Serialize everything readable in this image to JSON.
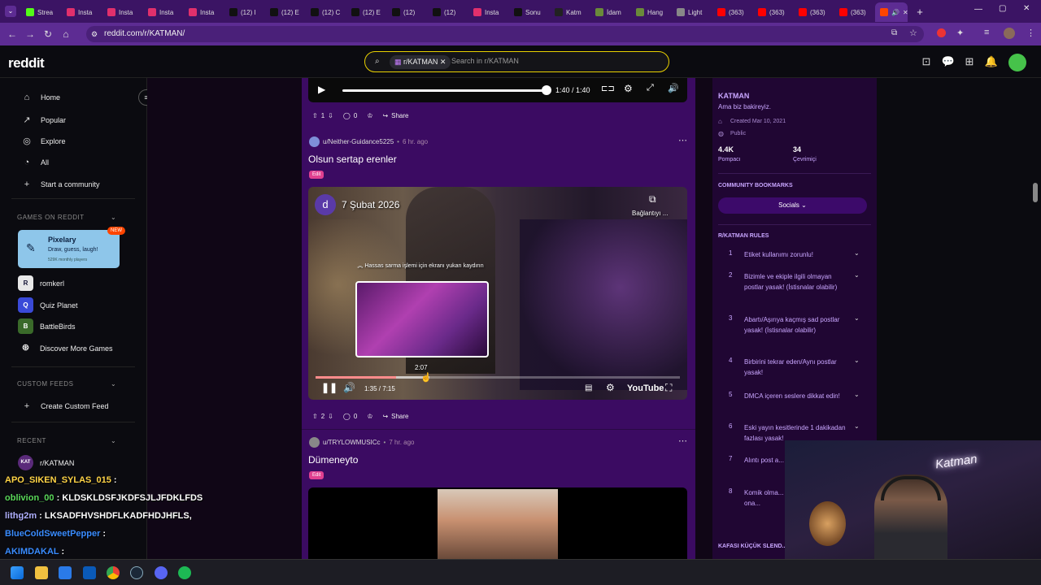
{
  "browser": {
    "tabs": [
      {
        "label": "Strea",
        "icon": "kick-icon",
        "color": "#53fc18"
      },
      {
        "label": "Insta",
        "icon": "instagram-icon",
        "color": "#e1306c"
      },
      {
        "label": "Insta",
        "icon": "instagram-icon",
        "color": "#e1306c"
      },
      {
        "label": "Insta",
        "icon": "instagram-icon",
        "color": "#e1306c"
      },
      {
        "label": "Insta",
        "icon": "instagram-icon",
        "color": "#e1306c"
      },
      {
        "label": "(12) I",
        "icon": "x-icon",
        "color": "#111111"
      },
      {
        "label": "(12) E",
        "icon": "x-icon",
        "color": "#111111"
      },
      {
        "label": "(12) C",
        "icon": "x-icon",
        "color": "#111111"
      },
      {
        "label": "(12) E",
        "icon": "x-icon",
        "color": "#111111"
      },
      {
        "label": "(12) ",
        "icon": "x-icon",
        "color": "#111111"
      },
      {
        "label": "(12) ",
        "icon": "x-icon",
        "color": "#111111"
      },
      {
        "label": "Insta",
        "icon": "instagram-icon",
        "color": "#e1306c"
      },
      {
        "label": "Sonu",
        "icon": "tiktok-icon",
        "color": "#111111"
      },
      {
        "label": "Katm",
        "icon": "github-icon",
        "color": "#222222"
      },
      {
        "label": "İdam",
        "icon": "globe-icon",
        "color": "#6a8a3a"
      },
      {
        "label": "Hang",
        "icon": "globe-icon",
        "color": "#6a8a3a"
      },
      {
        "label": "Light",
        "icon": "pen-icon",
        "color": "#888888"
      },
      {
        "label": "(363)",
        "icon": "youtube-icon",
        "color": "#ff0000"
      },
      {
        "label": "(363)",
        "icon": "youtube-icon",
        "color": "#ff0000"
      },
      {
        "label": "(363)",
        "icon": "youtube-icon",
        "color": "#ff0000"
      },
      {
        "label": "(363)",
        "icon": "youtube-icon",
        "color": "#ff0000"
      }
    ],
    "url": "reddit.com/r/KATMAN/"
  },
  "reddit": {
    "logo": "reddit",
    "search_chip": "r/KATMAN",
    "search_placeholder": "Search in r/KATMAN"
  },
  "sidebar": {
    "nav": [
      {
        "label": "Home",
        "icon": "home-icon"
      },
      {
        "label": "Popular",
        "icon": "popular-icon"
      },
      {
        "label": "Explore",
        "icon": "explore-icon"
      },
      {
        "label": "All",
        "icon": "all-icon"
      },
      {
        "label": "Start a community",
        "icon": "plus-icon"
      }
    ],
    "games_header": "GAMES ON REDDIT",
    "pixelary": {
      "title": "Pixelary",
      "tagline": "Draw, guess, laugh!",
      "players": "529K monthly players",
      "badge": "NEW"
    },
    "games": [
      "romkerl",
      "Quiz Planet",
      "BattleBirds",
      "Discover More Games"
    ],
    "custom_feeds_header": "CUSTOM FEEDS",
    "create_feed": "Create Custom Feed",
    "recent_header": "RECENT",
    "recent": [
      "r/KATMAN"
    ]
  },
  "feed": {
    "top_player": {
      "time": "1:40 / 1:40"
    },
    "post1": {
      "author": "u/Neither-Guidance5225",
      "age": "6 hr. ago",
      "title": "Olsun sertap erenler",
      "flair": "Edit",
      "votes": "1",
      "comments": "0",
      "share": "Share",
      "video": {
        "channel_initial": "d",
        "channel_title": "7 Şubat 2026",
        "copy_label": "Bağlantıyı ...",
        "hint": "Hassas sarma işlemi için ekranı yukarı kaydırın",
        "preview_time": "2:07",
        "time": "1:35 / 7:15",
        "brand": "YouTube",
        "progress": 0.22
      },
      "votes_after": "2",
      "comments_after": "0"
    },
    "post2": {
      "author": "u/TRYLOWMUSICc",
      "age": "7 hr. ago",
      "title": "Dümeneyto",
      "flair": "Edit"
    }
  },
  "community": {
    "name": "KATMAN",
    "tagline": "Ama biz bakireyiz.",
    "created": "Created Mar 10, 2021",
    "visibility": "Public",
    "members": "4.4K",
    "members_label": "Pompacı",
    "online": "34",
    "online_label": "Çevrimiçi",
    "bookmarks_header": "COMMUNITY BOOKMARKS",
    "bookmark_button": "Socials",
    "rules_header": "R/KATMAN RULES",
    "rules": [
      {
        "n": "1",
        "text": "Etiket kullanımı zorunlu!"
      },
      {
        "n": "2",
        "text": "Bizimle ve ekiple ilgili olmayan postlar yasak! (İstisnalar olabilir)"
      },
      {
        "n": "3",
        "text": "Abartı/Aşırıya kaçmış sad postlar yasak! (İstisnalar olabilir)"
      },
      {
        "n": "4",
        "text": "Birbirini tekrar eden/Aynı postlar yasak!"
      },
      {
        "n": "5",
        "text": "DMCA içeren seslere dikkat edin!"
      },
      {
        "n": "6",
        "text": "Eski yayın kesitlerinde 1 dakikadan fazlası yasak!"
      },
      {
        "n": "7",
        "text": "Alıntı post a... sahibini beli..."
      },
      {
        "n": "8",
        "text": "Komik olma... haftalık olar... akımları ona..."
      }
    ],
    "footer_header": "KAFASI KÜÇÜK SLEND..."
  },
  "stream": {
    "webcam_text": "Katman",
    "chat": [
      {
        "user": "APO_SIKEN_SYLAS_015",
        "message": "",
        "color": "#ffd447"
      },
      {
        "user": "oblivion_00",
        "message": "KLDSKLDSFJKDFSJLJFDKLFDS",
        "color": "#5bd95b"
      },
      {
        "user": "lithg2m",
        "message": "LKSADFHVSHDFLKADFHDJHFLS,",
        "color": "#b0b0ff"
      },
      {
        "user": "BlueColdSweetPepper",
        "message": "",
        "color": "#3a8cff"
      },
      {
        "user": "AKIMDAKAL",
        "message": "",
        "color": "#3a8cff"
      }
    ]
  }
}
